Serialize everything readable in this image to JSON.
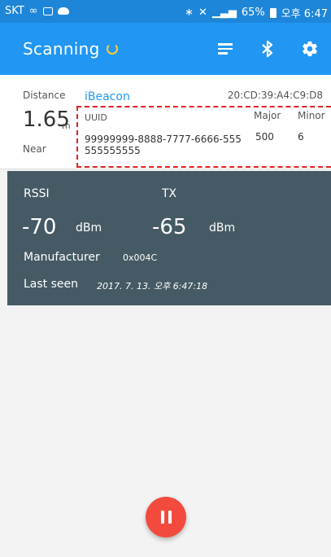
{
  "statusbar": {
    "carrier": "SKT",
    "battery": "65%",
    "time": "오후 6:47"
  },
  "appbar": {
    "title": "Scanning",
    "icons": [
      "menu-icon",
      "bluetooth-icon",
      "settings-gear-icon"
    ]
  },
  "beacon": {
    "distance_label": "Distance",
    "distance_value": "1.65",
    "distance_unit": "m",
    "proximity": "Near",
    "type": "iBeacon",
    "mac": "20:CD:39:A4:C9:D8",
    "uuid_label": "UUID",
    "uuid_value": "99999999-8888-7777-6666-555555555555",
    "major_label": "Major",
    "minor_label": "Minor",
    "major_value": "500",
    "minor_value": "6"
  },
  "details": {
    "rssi_label": "RSSI",
    "rssi_value": "-70",
    "rssi_unit": "dBm",
    "tx_label": "TX",
    "tx_value": "-65",
    "tx_unit": "dBm",
    "manufacturer_label": "Manufacturer",
    "manufacturer_value": "0x004C",
    "last_seen_label": "Last seen",
    "last_seen_value": "2017. 7. 13. 오후 6:47:18"
  },
  "colors": {
    "primary": "#2196f3",
    "status_bar": "#1d86d9",
    "panel": "#455a64",
    "fab": "#f24b3e",
    "highlight": "#e02020"
  }
}
